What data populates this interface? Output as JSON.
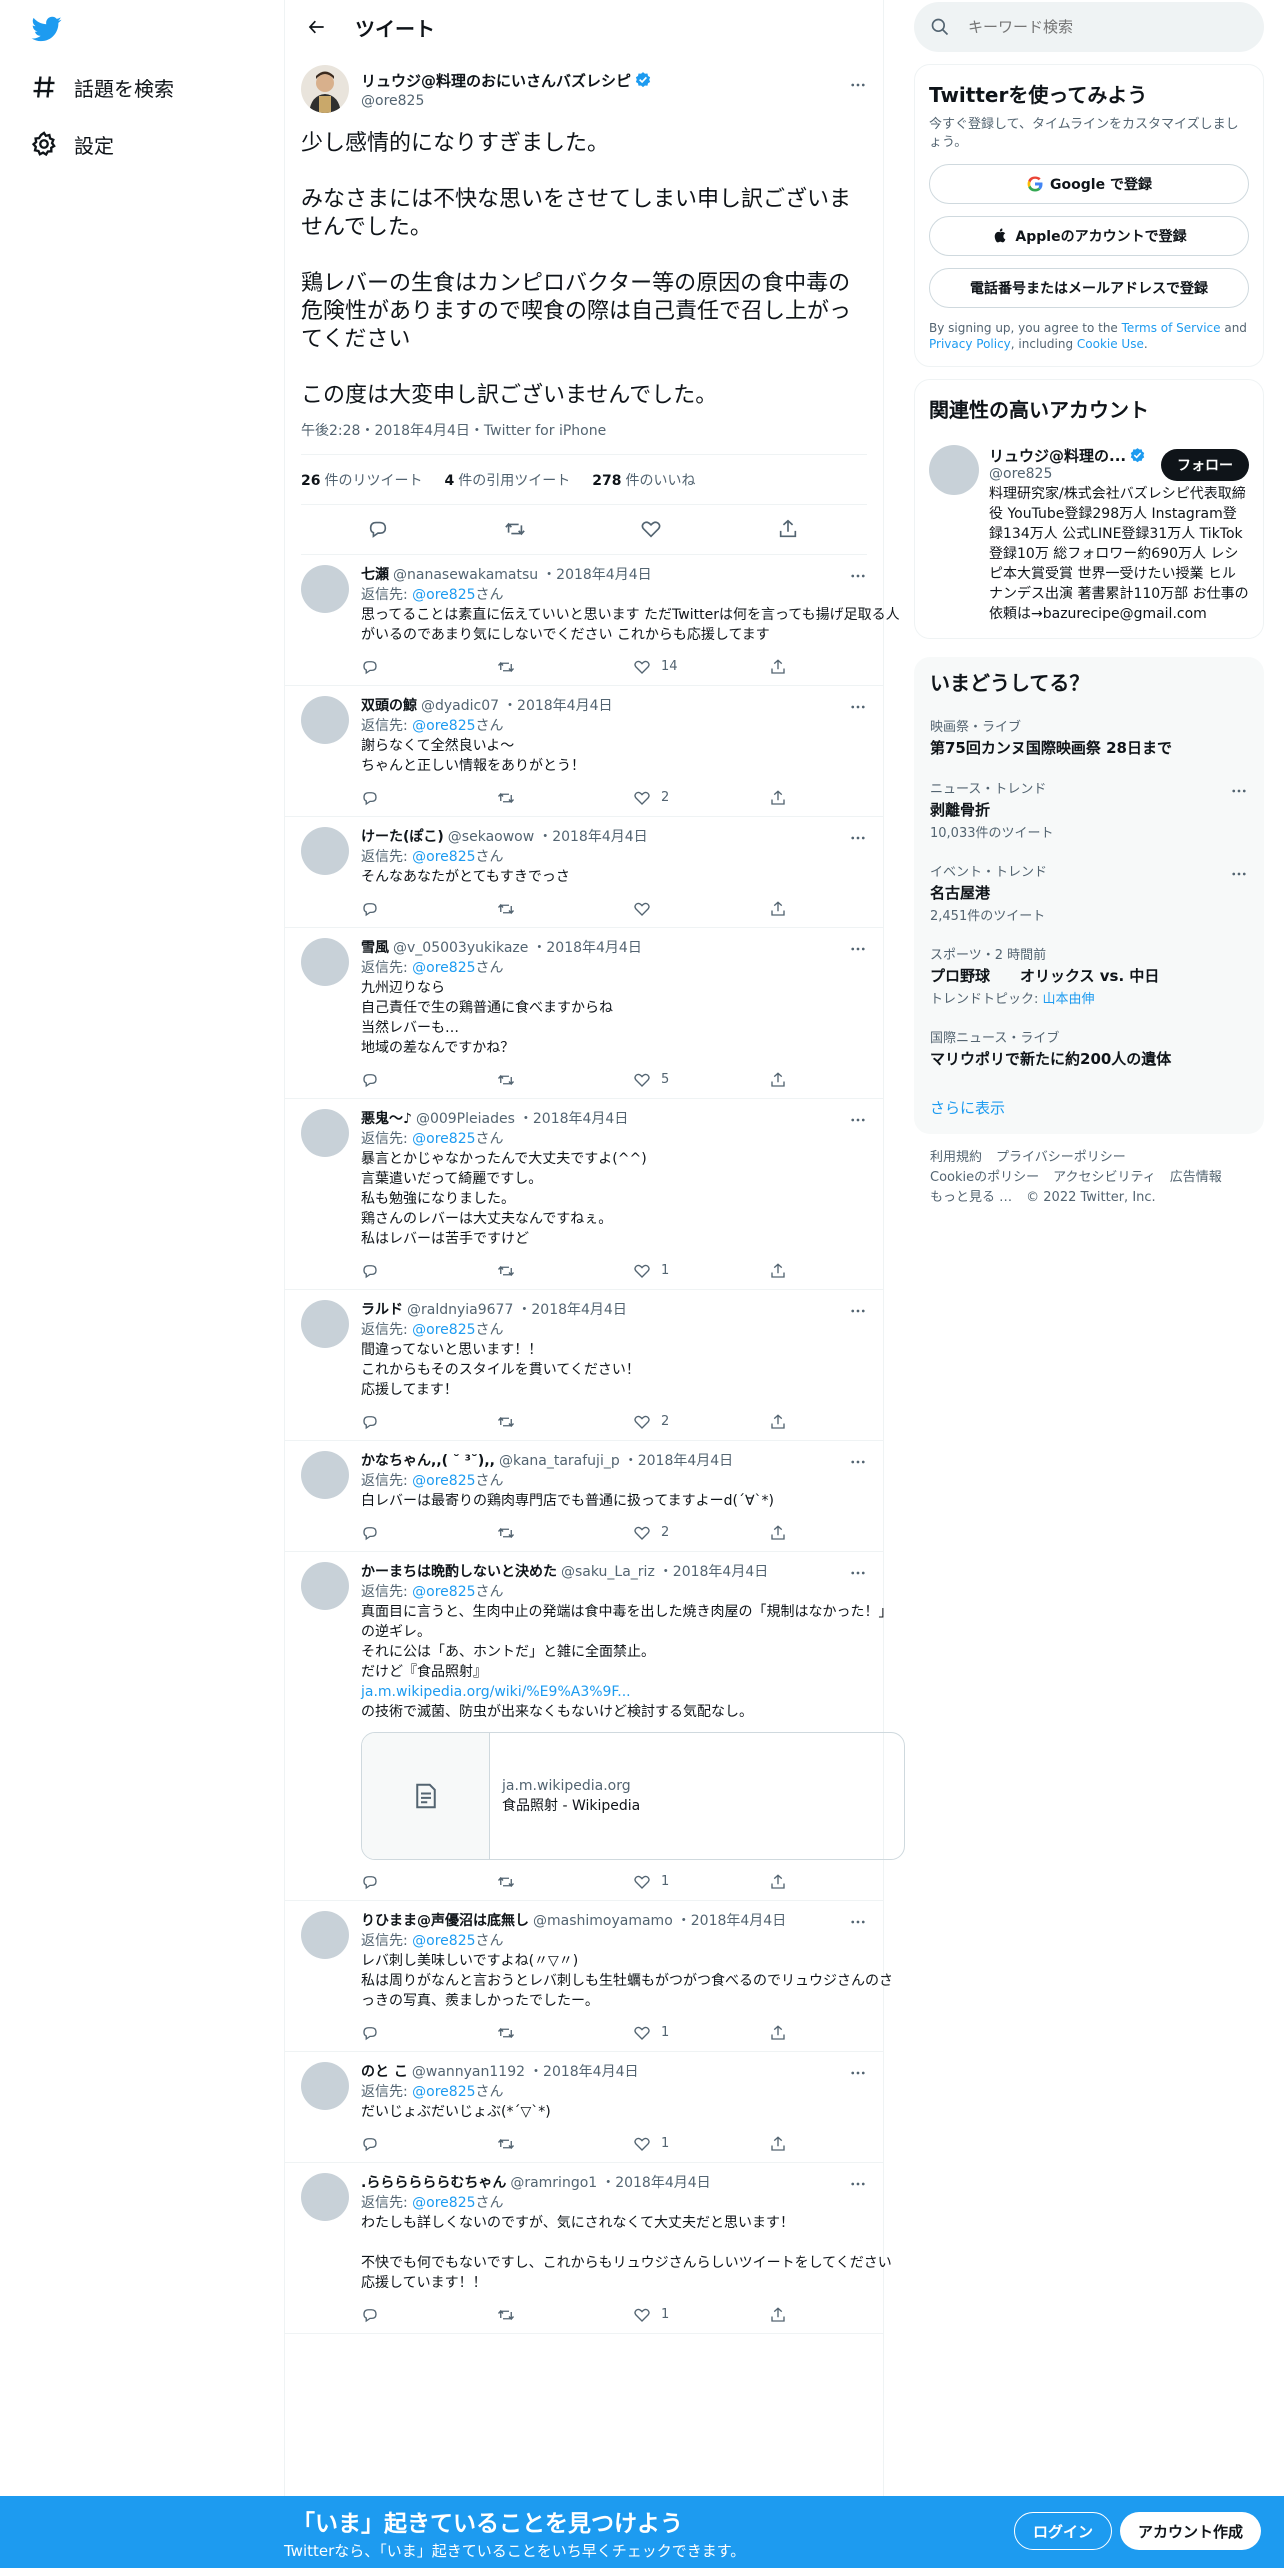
{
  "nav": {
    "items": [
      {
        "label": "話題を検索",
        "icon": "hashtag-icon"
      },
      {
        "label": "設定",
        "icon": "gear-icon"
      }
    ]
  },
  "header": {
    "title": "ツイート"
  },
  "tweet": {
    "name": "リュウジ@料理のおにいさんバズレシピ",
    "handle": "@ore825",
    "text": "少し感情的になりすぎました。\n\nみなさまには不快な思いをさせてしまい申し訳ございませんでした。\n\n鶏レバーの生食はカンピロバクター等の原因の食中毒の危険性がありますので喫食の際は自己責任で召し上がってください\n\nこの度は大変申し訳ございませんでした。",
    "meta": "午後2:28・2018年4月4日・Twitter for iPhone",
    "retweets": "26",
    "retweets_label": "件のリツイート",
    "quotes": "4",
    "quotes_label": "件の引用ツイート",
    "likes": "278",
    "likes_label": "件のいいね"
  },
  "replies": [
    {
      "name": "七瀬",
      "handle": "@nanasewakamatsu",
      "date": "2018年4月4日",
      "to": "@ore825",
      "text": "思ってることは素直に伝えていいと思います ただTwitterは何を言っても揚げ足取る人がいるのであまり気にしないでください これからも応援してます",
      "likes": "14"
    },
    {
      "name": "双頭の鯨",
      "handle": "@dyadic07",
      "date": "2018年4月4日",
      "to": "@ore825",
      "text": "謝らなくて全然良いよ〜\nちゃんと正しい情報をありがとう！",
      "likes": "2"
    },
    {
      "name": "けーた(ぽこ)",
      "handle": "@sekaowow",
      "date": "2018年4月4日",
      "to": "@ore825",
      "text": "そんなあなたがとてもすきでっさ",
      "likes": ""
    },
    {
      "name": "雪風",
      "handle": "@v_05003yukikaze",
      "date": "2018年4月4日",
      "to": "@ore825",
      "text": "九州辺りなら\n自己責任で生の鶏普通に食べますからね\n当然レバーも…\n地域の差なんですかね？",
      "likes": "5"
    },
    {
      "name": "悪鬼〜♪",
      "handle": "@009Pleiades",
      "date": "2018年4月4日",
      "to": "@ore825",
      "text": "暴言とかじゃなかったんで大丈夫ですよ(^^)\n言葉遣いだって綺麗ですし。\n私も勉強になりました。\n鶏さんのレバーは大丈夫なんですねぇ。\n私はレバーは苦手ですけど",
      "likes": "1"
    },
    {
      "name": "ラルド",
      "handle": "@raldnyia9677",
      "date": "2018年4月4日",
      "to": "@ore825",
      "text": "間違ってないと思います！！\nこれからもそのスタイルを貫いてください！\n応援してます！",
      "likes": "2"
    },
    {
      "name": "かなちゃん,,( ˘ ³˘),,",
      "handle": "@kana_tarafuji_p",
      "date": "2018年4月4日",
      "to": "@ore825",
      "text": "白レバーは最寄りの鶏肉専門店でも普通に扱ってますよーd(´∀`*)",
      "likes": "2"
    }
  ],
  "reply_link": {
    "name": "かーまちは晩酌しないと決めた",
    "handle": "@saku_La_riz",
    "date": "2018年4月4日",
    "to": "@ore825",
    "text1": "真面目に言うと、生肉中止の発端は食中毒を出した焼き肉屋の「規制はなかった！」の逆ギレ。\nそれに公は「あ、ホントだ」と雑に全面禁止。\nだけど『食品照射』",
    "link": "ja.m.wikipedia.org/wiki/%E9%A3%9F...",
    "text2": "の技術で滅菌、防虫が出来なくもないけど検討する気配なし。",
    "card_domain": "ja.m.wikipedia.org",
    "card_title": "食品照射 - Wikipedia",
    "likes": "1"
  },
  "replies2": [
    {
      "name": "りひまま@声優沼は底無し",
      "handle": "@mashimoyamamo",
      "date": "2018年4月4日",
      "to": "@ore825",
      "text": "レバ刺し美味しいですよね(〃▽〃)\n私は周りがなんと言おうとレバ刺しも生牡蠣もがつがつ食べるのでリュウジさんのさっきの写真、羨ましかったでしたー。",
      "likes": "1"
    },
    {
      "name": "のと こ",
      "handle": "@wannyan1192",
      "date": "2018年4月4日",
      "to": "@ore825",
      "text": "だいじょぶだいじょぶ(*´▽`*)",
      "likes": "1"
    },
    {
      "name": ".ららららららむちゃん",
      "handle": "@ramringo1",
      "date": "2018年4月4日",
      "to": "@ore825",
      "text": "わたしも詳しくないのですが、気にされなくて大丈夫だと思います！\n\n不快でも何でもないですし、これからもリュウジさんらしいツイートをしてください　応援しています！！",
      "likes": "1"
    }
  ],
  "labels": {
    "replying_to": "返信先:",
    "san": "さん"
  },
  "search": {
    "placeholder": "キーワード検索"
  },
  "signup": {
    "title": "Twitterを使ってみよう",
    "subtitle": "今すぐ登録して、タイムラインをカスタマイズしましょう。",
    "google": "Google で登録",
    "apple": "Appleのアカウントで登録",
    "phone": "電話番号またはメールアドレスで登録",
    "note_pre": "By signing up, you agree to the ",
    "terms": "Terms of Service",
    "note_and": " and ",
    "privacy": "Privacy Policy",
    "note_inc": ", including ",
    "cookie": "Cookie Use",
    "note_end": "."
  },
  "related": {
    "title": "関連性の高いアカウント",
    "name": "リュウジ@料理の...",
    "handle": "@ore825",
    "bio": "料理研究家/株式会社バズレシピ代表取締役 YouTube登録298万人 Instagram登録134万人 公式LINE登録31万人 TikTok登録10万 総フォロワー約690万人 レシピ本大賞受賞 世界一受けたい授業 ヒルナンデス出演 著書累計110万部 お仕事の依頼は→bazurecipe@gmail.com",
    "follow": "フォロー"
  },
  "trends": {
    "title": "いまどうしてる？",
    "items": [
      {
        "ctx": "映画祭・ライブ",
        "title": "第75回カンヌ国際映画祭 28日まで",
        "sub": "",
        "sub_link": ""
      },
      {
        "ctx": "ニュース・トレンド",
        "title": "剥離骨折",
        "sub": "10,033件のツイート",
        "sub_link": ""
      },
      {
        "ctx": "イベント・トレンド",
        "title": "名古屋港",
        "sub": "2,451件のツイート",
        "sub_link": ""
      },
      {
        "ctx": "スポーツ・2 時間前",
        "title": "プロ野球　　オリックス vs. 中日",
        "sub": "トレンドトピック: ",
        "sub_link": "山本由伸"
      },
      {
        "ctx": "国際ニュース・ライブ",
        "title": "マリウポリで新たに約200人の遺体",
        "sub": "",
        "sub_link": ""
      }
    ],
    "show_more": "さらに表示"
  },
  "footer": {
    "line1": [
      "利用規約",
      "プライバシーポリシー"
    ],
    "line2": [
      "Cookieのポリシー",
      "アクセシビリティ",
      "広告情報"
    ],
    "line3": [
      "もっと見る …",
      "© 2022 Twitter, Inc."
    ]
  },
  "bottom": {
    "title": "「いま」起きていることを見つけよう",
    "subtitle": "Twitterなら、「いま」起きていることをいち早くチェックできます。",
    "login": "ログイン",
    "signup": "アカウント作成"
  },
  "colors": {
    "accent": "#1d9bf0",
    "text": "#0f1419",
    "muted": "#536471"
  }
}
